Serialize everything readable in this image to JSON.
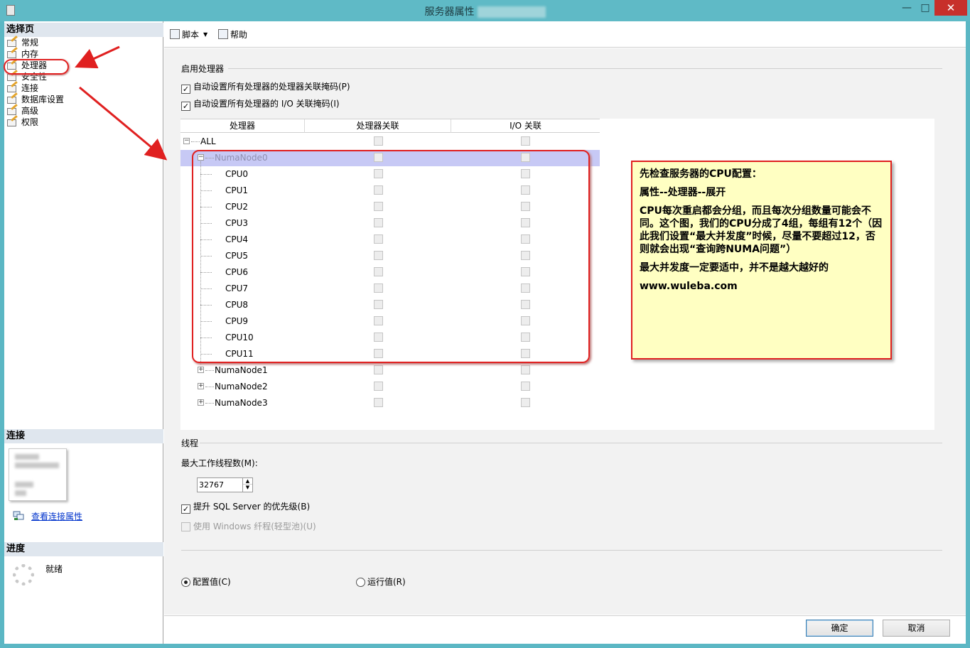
{
  "window": {
    "title": "服务器属性",
    "title_suffix": "",
    "minimize": "—",
    "maximize": "□",
    "close": "✕"
  },
  "left": {
    "select_page_header": "选择页",
    "pages": [
      "常规",
      "内存",
      "处理器",
      "安全性",
      "连接",
      "数据库设置",
      "高级",
      "权限"
    ],
    "connection_header": "连接",
    "view_connection_link": "查看连接属性",
    "progress_header": "进度",
    "progress_status": "就绪"
  },
  "toolbar": {
    "script_label": "脚本",
    "help_label": "帮助"
  },
  "processor": {
    "group_label": "启用处理器",
    "auto_affinity_label": "自动设置所有处理器的处理器关联掩码(P)",
    "auto_affinity_checked": true,
    "auto_io_label": "自动设置所有处理器的 I/O 关联掩码(I)",
    "auto_io_checked": true,
    "columns": [
      "处理器",
      "处理器关联",
      "I/O 关联"
    ],
    "rows": [
      {
        "name": "ALL",
        "level": 0,
        "expander": "⊟"
      },
      {
        "name": "NumaNode0",
        "level": 1,
        "expander": "⊟",
        "selected": true
      },
      {
        "name": "CPU0",
        "level": 2
      },
      {
        "name": "CPU1",
        "level": 2
      },
      {
        "name": "CPU2",
        "level": 2
      },
      {
        "name": "CPU3",
        "level": 2
      },
      {
        "name": "CPU4",
        "level": 2
      },
      {
        "name": "CPU5",
        "level": 2
      },
      {
        "name": "CPU6",
        "level": 2
      },
      {
        "name": "CPU7",
        "level": 2
      },
      {
        "name": "CPU8",
        "level": 2
      },
      {
        "name": "CPU9",
        "level": 2
      },
      {
        "name": "CPU10",
        "level": 2
      },
      {
        "name": "CPU11",
        "level": 2
      },
      {
        "name": "NumaNode1",
        "level": 1,
        "expander": "⊞"
      },
      {
        "name": "NumaNode2",
        "level": 1,
        "expander": "⊞"
      },
      {
        "name": "NumaNode3",
        "level": 1,
        "expander": "⊞"
      }
    ]
  },
  "threads": {
    "group_label": "线程",
    "max_worker_label": "最大工作线程数(M):",
    "max_worker_value": "32767",
    "boost_label": "提升 SQL Server 的优先级(B)",
    "boost_checked": true,
    "fiber_label": "使用 Windows 纤程(轻型池)(U)",
    "fiber_checked": false
  },
  "radios": {
    "configured_label": "配置值(C)",
    "running_label": "运行值(R)",
    "selected": "configured"
  },
  "buttons": {
    "ok": "确定",
    "cancel": "取消"
  },
  "annotation": {
    "line1": "先检查服务器的CPU配置：",
    "line2": "属性--处理器--展开",
    "line3": "CPU每次重启都会分组，而且每次分组数量可能会不同。这个图，我们的CPU分成了4组，每组有12个（因此我们设置“最大并发度”时候，尽量不要超过12，否则就会出现“查询跨NUMA问题”）",
    "line4": "最大并发度一定要适中，并不是越大越好的",
    "line5": "www.wuleba.com"
  },
  "colors": {
    "title_bar": "#5fbac6",
    "annotation_red": "#e02020",
    "note_background": "#ffffc2",
    "selected_row": "#c7c9f5"
  }
}
